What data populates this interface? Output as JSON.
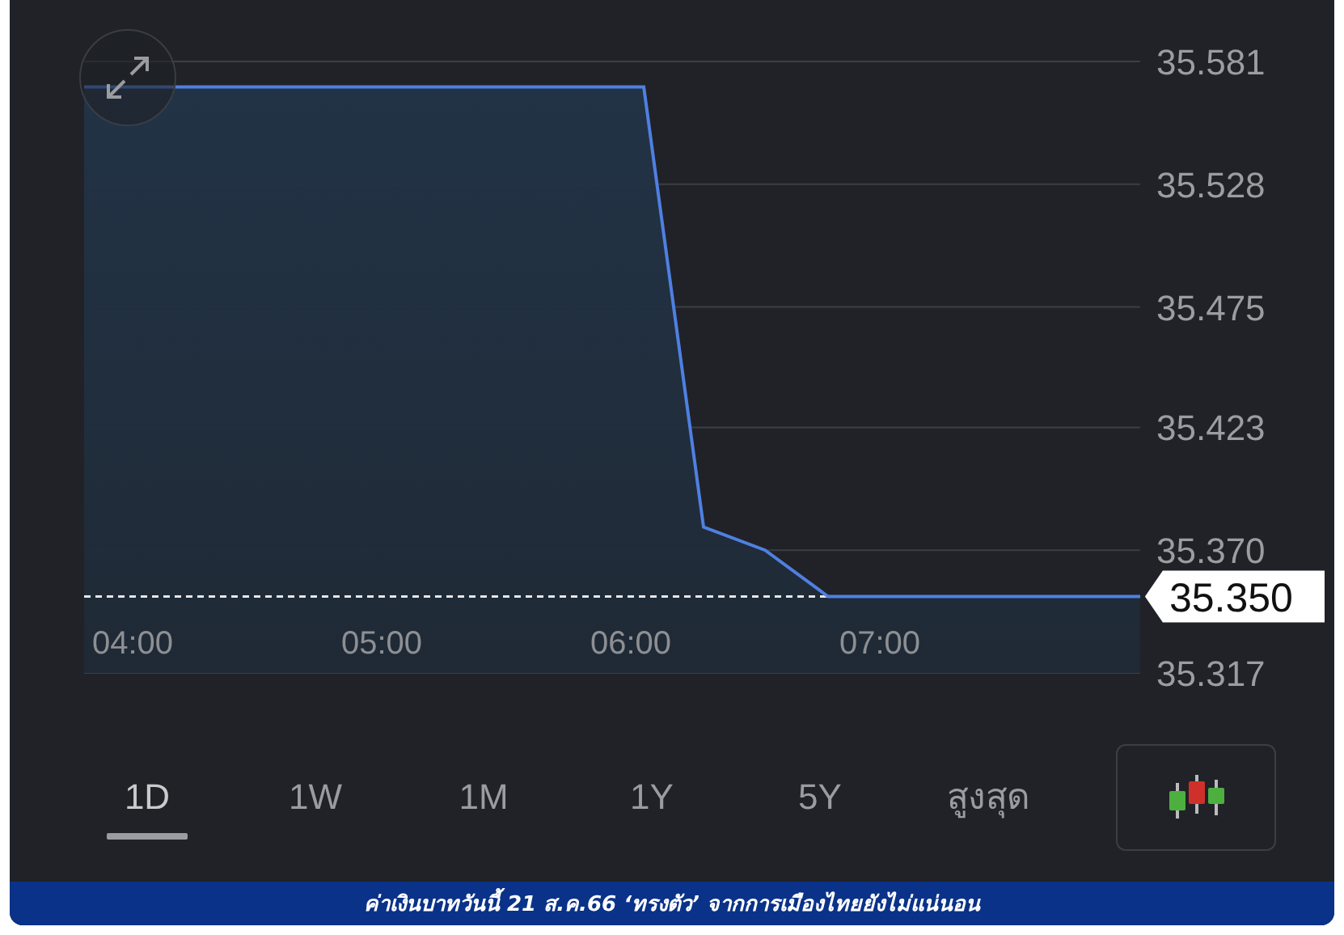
{
  "chart": {
    "chart_data": {
      "type": "area",
      "grid": true,
      "x": [
        3.805,
        6.052,
        6.292,
        6.539,
        6.792,
        8.045
      ],
      "series": [
        {
          "color": "#4f80e1",
          "values": [
            35.57,
            35.57,
            35.38,
            35.37,
            35.35,
            35.35
          ]
        }
      ],
      "xlim": [
        3.805,
        8.045
      ],
      "ylim": [
        35.317,
        35.581
      ],
      "xticks": [
        {
          "value": 4,
          "label": "04:00"
        },
        {
          "value": 5,
          "label": "05:00"
        },
        {
          "value": 6,
          "label": "06:00"
        },
        {
          "value": 7,
          "label": "07:00"
        }
      ],
      "yticks": [
        {
          "value": 35.581,
          "label": "35.581"
        },
        {
          "value": 35.528,
          "label": "35.528"
        },
        {
          "value": 35.475,
          "label": "35.475"
        },
        {
          "value": 35.423,
          "label": "35.423"
        },
        {
          "value": 35.37,
          "label": "35.370"
        },
        {
          "value": 35.317,
          "label": "35.317"
        }
      ],
      "ref_lines": [
        {
          "axis": "y",
          "value": 35.35,
          "label": "35.350"
        }
      ]
    }
  },
  "ranges": [
    {
      "label": "1D",
      "selected": true
    },
    {
      "label": "1W",
      "selected": false
    },
    {
      "label": "1M",
      "selected": false
    },
    {
      "label": "1Y",
      "selected": false
    },
    {
      "label": "5Y",
      "selected": false
    },
    {
      "label": "สูงสุด",
      "selected": false
    }
  ],
  "caption": "ค่าเงินบาทวันนี้ 21 ส.ค.66 ‘ทรงตัว’ จากการเมืองไทยยังไม่แน่นอน"
}
